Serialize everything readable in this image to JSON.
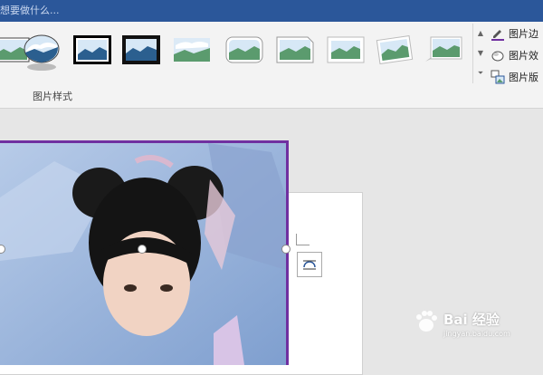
{
  "tell_me": {
    "placeholder": "想要做什么..."
  },
  "ribbon": {
    "picture_styles": {
      "group_label": "图片样式",
      "thumbnails": [
        "picture-style-simple-frame",
        "picture-style-oval",
        "picture-style-thick-black",
        "picture-style-black-frame",
        "picture-style-soft-edge",
        "picture-style-rounded",
        "picture-style-snip-corner",
        "picture-style-white-frame",
        "picture-style-rotated",
        "picture-style-perspective"
      ]
    },
    "side_commands": {
      "border": "图片边",
      "effects": "图片效",
      "layout": "图片版"
    }
  },
  "colors": {
    "title_bar": "#2b579a",
    "ribbon_bg": "#f3f3f3",
    "picture_border": "#7030a0",
    "canvas_bg": "#e6e6e6"
  },
  "watermark": {
    "brand": "Bai 经验",
    "url": "jingyan.baidu.com"
  }
}
